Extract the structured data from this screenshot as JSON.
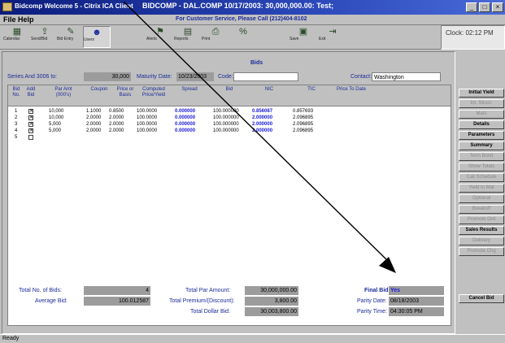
{
  "window": {
    "app_title": "Bidcomp Welcome 5 - Citrix ICA Client",
    "title": "BIDCOMP - DAL.COMP 10/17/2003: 30,000,000.00: Test;"
  },
  "menu": {
    "file": "File",
    "help": "Help",
    "customer_service": "For Customer Service, Please Call (212)404-8102"
  },
  "toolbar": [
    {
      "label": "Calendar",
      "icon": "calendar-icon"
    },
    {
      "label": "Send/Bid",
      "icon": "send-icon"
    },
    {
      "label": "Bid Entry",
      "icon": "bid-entry-icon"
    },
    {
      "label": "Users",
      "icon": "users-icon"
    },
    {
      "label": "",
      "icon": "blank-icon"
    },
    {
      "label": "Alerts",
      "icon": "alerts-icon"
    },
    {
      "label": "Reports",
      "icon": "reports-icon"
    },
    {
      "label": "Print",
      "icon": "print-icon"
    },
    {
      "label": "",
      "icon": "calc-icon"
    },
    {
      "label": "",
      "icon": "blank-icon"
    },
    {
      "label": "Save",
      "icon": "save-icon"
    },
    {
      "label": "Exit",
      "icon": "exit-icon"
    }
  ],
  "clock": "Clock: 02:12 PM",
  "section_title": "Bids",
  "top_fields": {
    "series_label": "Series And 3006 to:",
    "series_value": "30,000",
    "maturity_label": "Maturity Date:",
    "maturity_value": "10/23/2003",
    "code_label": "Code:",
    "code_value": "",
    "contact_label": "Contact:",
    "contact_value": "Washington"
  },
  "grid": {
    "headers": [
      "Bid No.",
      "Add Bid",
      "Par Amt (000's)",
      "Coupon",
      "Price or Basis",
      "Computed Price/Yield",
      "Spread",
      "Bid",
      "NIC",
      "TIC",
      "Price To Date"
    ],
    "rows": [
      {
        "no": "1",
        "checked": true,
        "par": "10,000",
        "coupon": "1.1000",
        "price": "0.8500",
        "computed": "100.0000",
        "spread": "0.000000",
        "bid": "100.000000",
        "nic": "0.856087",
        "tic": "0.857693"
      },
      {
        "no": "2",
        "checked": true,
        "par": "10,000",
        "coupon": "2.0000",
        "price": "2.0000",
        "computed": "100.0000",
        "spread": "0.000000",
        "bid": "100.000000",
        "nic": "2.000000",
        "tic": "2.096895"
      },
      {
        "no": "3",
        "checked": true,
        "par": "5,000",
        "coupon": "2.0000",
        "price": "2.0000",
        "computed": "100.0000",
        "spread": "0.000000",
        "bid": "100.000000",
        "nic": "2.000000",
        "tic": "2.096895"
      },
      {
        "no": "4",
        "checked": true,
        "par": "5,000",
        "coupon": "2.0000",
        "price": "2.0000",
        "computed": "100.0000",
        "spread": "0.000000",
        "bid": "100.000000",
        "nic": "2.000000",
        "tic": "2.096895"
      },
      {
        "no": "5",
        "checked": false,
        "par": "",
        "coupon": "",
        "price": "",
        "computed": "",
        "spread": "",
        "bid": "",
        "nic": "",
        "tic": ""
      }
    ]
  },
  "bottom": {
    "total_bids_label": "Total No. of Bids:",
    "total_bids_value": "4",
    "average_bid_label": "Average Bid:",
    "average_bid_value": "100.012587",
    "total_par_label": "Total Par Amount:",
    "total_par_value": "30,000,000.00",
    "premium_label": "Total Premium/(Discount):",
    "premium_value": "3,800.00",
    "dollar_bid_label": "Total Dollar Bid:",
    "dollar_bid_value": "30,003,800.00",
    "final_bid_label": "Final Bid:",
    "final_bid_value": "Yes",
    "parity_date_label": "Parity Date:",
    "parity_date_value": "08/18/2003",
    "parity_time_label": "Parity Time:",
    "parity_time_value": "04:30:05 PM"
  },
  "right_buttons": [
    {
      "label": "Initial Yield",
      "enabled": true
    },
    {
      "label": "Int. Struct.",
      "enabled": false
    },
    {
      "label": "Mats",
      "enabled": false
    },
    {
      "label": "Details",
      "enabled": true
    },
    {
      "label": "Parameters",
      "enabled": true
    },
    {
      "label": "Summary",
      "enabled": true
    },
    {
      "label": "Term Bond",
      "enabled": false
    },
    {
      "label": "Show Totals",
      "enabled": false
    },
    {
      "label": "Call Schedule",
      "enabled": false
    },
    {
      "label": "Yield to Mat",
      "enabled": false
    },
    {
      "label": "Optional",
      "enabled": false
    },
    {
      "label": "Breakoff",
      "enabled": false
    },
    {
      "label": "Promote Ord",
      "enabled": false
    },
    {
      "label": "Sales Results",
      "enabled": true
    },
    {
      "label": "Delivery",
      "enabled": false
    },
    {
      "label": "Promote Chg",
      "enabled": false
    }
  ],
  "cancel_button": "Cancel Bid",
  "status": "Ready",
  "colors": {
    "title_bar": "#1a2b9a",
    "highlight_blue": "#1a1ad8",
    "field_gray": "#9c9c9c"
  }
}
